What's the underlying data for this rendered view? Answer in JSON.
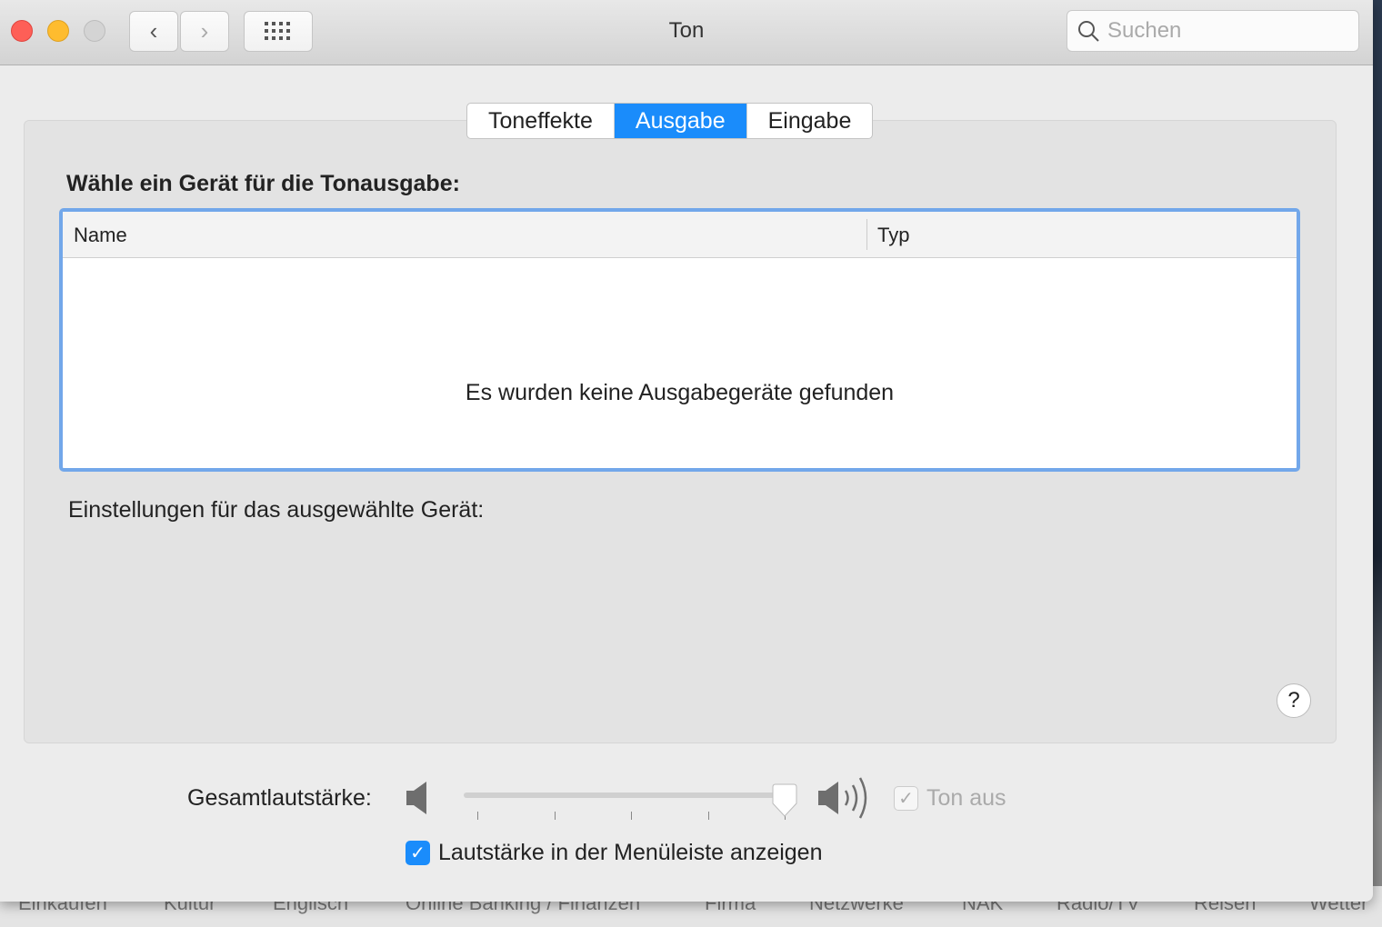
{
  "window": {
    "title": "Ton",
    "search_placeholder": "Suchen",
    "colors": {
      "close": "#fe5f57",
      "minimize": "#febc2e",
      "accent": "#1a8cfb"
    }
  },
  "tabs": [
    {
      "label": "Toneffekte",
      "selected": false
    },
    {
      "label": "Ausgabe",
      "selected": true
    },
    {
      "label": "Eingabe",
      "selected": false
    }
  ],
  "output": {
    "heading": "Wähle ein Gerät für die Tonausgabe:",
    "columns": [
      "Name",
      "Typ"
    ],
    "empty_message": "Es wurden keine Ausgabegeräte gefunden",
    "settings_label": "Einstellungen für das ausgewählte Gerät:"
  },
  "help": "?",
  "volume": {
    "label": "Gesamtlautstärke:",
    "level_percent": 100,
    "mute_label": "Ton aus",
    "mute_checked": true,
    "mute_disabled": true,
    "menubar_label": "Lautstärke in der Menüleiste anzeigen",
    "menubar_checked": true
  },
  "background_bookmarks": [
    "Einkaufen",
    "Kultur",
    "Englisch",
    "Online Banking / Finanzen",
    "Firma",
    "Netzwerke",
    "NAK",
    "Radio/TV",
    "Reisen",
    "Wetter"
  ]
}
